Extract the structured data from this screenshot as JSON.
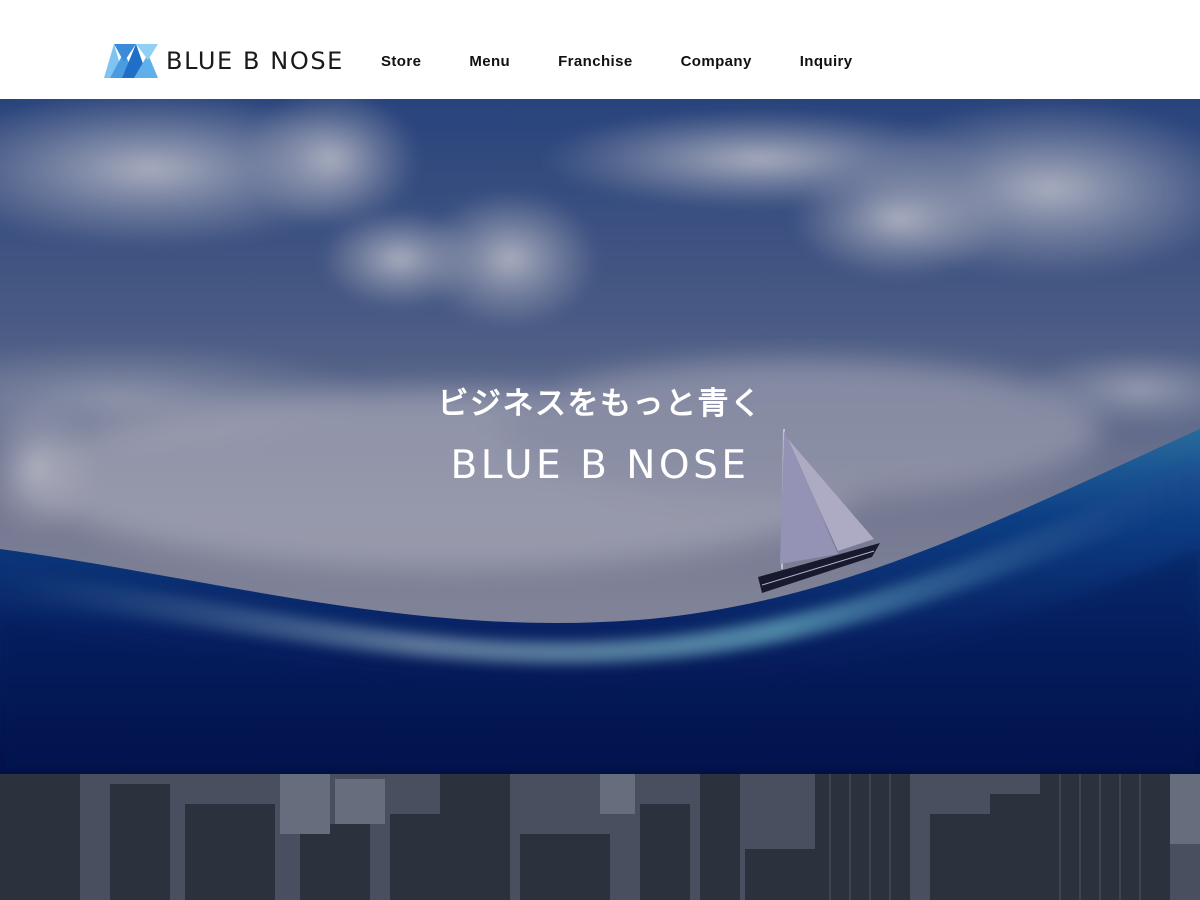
{
  "header": {
    "logo_text": "BLUE B NOSE",
    "logo_icon": "chevron-triangles-logo",
    "nav": [
      {
        "label": "Store"
      },
      {
        "label": "Menu"
      },
      {
        "label": "Franchise"
      },
      {
        "label": "Company"
      },
      {
        "label": "Inquiry"
      }
    ]
  },
  "hero": {
    "tagline": "ビジネスをもっと青く",
    "title": "BLUE B NOSE",
    "image_subject": "sailboat-on-wave-under-clouds"
  },
  "city": {
    "image_subject": "city-skyline"
  },
  "colors": {
    "logo_dark_blue": "#1f6fc8",
    "logo_light_blue": "#7fc3f0",
    "text_dark": "#111111",
    "hero_text": "#ffffff",
    "wave_deep": "#02105a"
  }
}
